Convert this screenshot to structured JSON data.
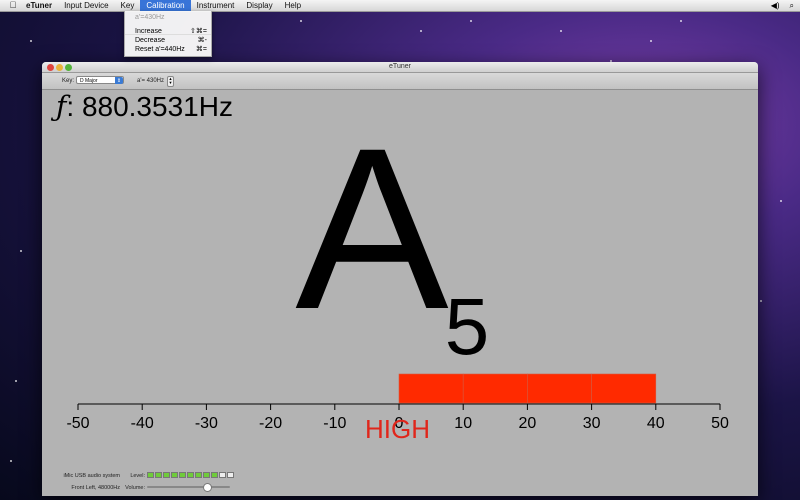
{
  "menubar": {
    "apple_icon": "",
    "app_name": "eTuner",
    "items": [
      "Input Device",
      "Key",
      "Calibration",
      "Instrument",
      "Display",
      "Help"
    ],
    "active": "Calibration",
    "status_icons": [
      "volume-icon",
      "spotlight-icon"
    ]
  },
  "calibration_menu": {
    "current": "a'=430Hz",
    "items": [
      {
        "label": "Increase",
        "shortcut": "⇧⌘="
      },
      {
        "label": "Decrease",
        "shortcut": "⌘-"
      },
      {
        "label": "Reset a'=440Hz",
        "shortcut": "⌘="
      }
    ]
  },
  "window": {
    "title": "eTuner",
    "key_label": "Key:",
    "key_value": "D Major",
    "calib_value": "a'= 430Hz"
  },
  "display": {
    "frequency": "880.3531Hz",
    "note_letter": "A",
    "note_octave": "5",
    "status": "HIGH",
    "meter_colors": {
      "fill": "#ff2a00",
      "status": "#e0261b"
    }
  },
  "meter": {
    "ticks": [
      "-50",
      "-40",
      "-30",
      "-20",
      "-10",
      "0",
      "10",
      "20",
      "30",
      "40",
      "50"
    ],
    "deviation_start": 0,
    "deviation_end": 40
  },
  "status": {
    "device": "iMic USB audio system",
    "channel": "Front Left, 48000Hz",
    "level_label": "Level:",
    "volume_label": "Volume:",
    "level_segments_lit": 9,
    "level_segments_total": 11,
    "volume_fraction": 0.72
  }
}
